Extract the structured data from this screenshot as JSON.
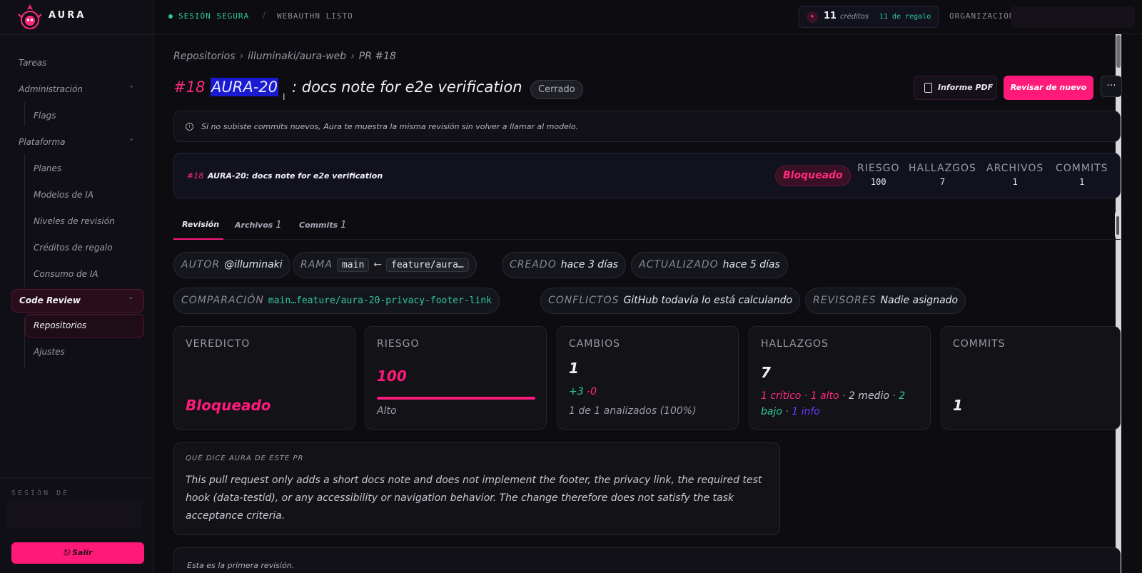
{
  "app": {
    "name": "AURA"
  },
  "topbar": {
    "secure": "SESIÓN SEGURA",
    "separator": "/",
    "webauthn": "WEBAUTHN LISTO",
    "credits_num": "11",
    "credits_label": "créditos",
    "credits_gift": "11 de regalo",
    "org_label": "ORGANIZACIÓN"
  },
  "sidebar": {
    "items": [
      {
        "label": "Tareas"
      },
      {
        "label": "Administración"
      },
      {
        "label": "Flags"
      },
      {
        "label": "Plataforma"
      },
      {
        "label": "Planes"
      },
      {
        "label": "Modelos de IA"
      },
      {
        "label": "Niveles de revisión"
      },
      {
        "label": "Créditos de regalo"
      },
      {
        "label": "Consumo de IA"
      },
      {
        "label": "Code Review"
      },
      {
        "label": "Repositorios"
      },
      {
        "label": "Ajustes"
      }
    ],
    "session_label": "SESIÓN DE",
    "logout": "Salir"
  },
  "breadcrumb": {
    "items": [
      "Repositorios",
      "illuminaki/aura-web",
      "PR #18"
    ],
    "sep": "›"
  },
  "pr": {
    "number": "#18",
    "key": "AURA-20",
    "title": ": docs note for e2e verification",
    "status": "Cerrado",
    "pdf_label": "Informe PDF",
    "review_label": "Revisar de nuevo",
    "more_label": "···"
  },
  "notice": {
    "text": "Si no subiste commits nuevos, Aura te muestra la misma revisión sin volver a llamar al modelo."
  },
  "summary": {
    "num": "#18",
    "title": "AURA-20: docs note for e2e verification",
    "badge": "Bloqueado",
    "stats": [
      {
        "key": "RIESGO",
        "value": "100"
      },
      {
        "key": "HALLAZGOS",
        "value": "7"
      },
      {
        "key": "ARCHIVOS",
        "value": "1"
      },
      {
        "key": "COMMITS",
        "value": "1"
      }
    ]
  },
  "tabs": [
    {
      "label": "Revisión",
      "count": ""
    },
    {
      "label": "Archivos",
      "count": "1"
    },
    {
      "label": "Commits",
      "count": "1"
    }
  ],
  "meta": {
    "author_k": "AUTOR",
    "author_v": "@illuminaki",
    "branch_k": "RAMA",
    "branch_base": "main",
    "branch_arrow": "←",
    "branch_head": "feature/aura…",
    "created_k": "CREADO",
    "created_v": "hace 3 días",
    "updated_k": "ACTUALIZADO",
    "updated_v": "hace 5 días",
    "compare_k": "COMPARACIÓN",
    "compare_v": "main…feature/aura-20-privacy-footer-link",
    "conflicts_k": "CONFLICTOS",
    "conflicts_v": "GitHub todavía lo está calculando",
    "reviewers_k": "REVISORES",
    "reviewers_v": "Nadie asignado"
  },
  "cards": {
    "verdict_k": "VEREDICTO",
    "verdict_v": "Bloqueado",
    "risk_k": "RIESGO",
    "risk_v": "100",
    "risk_level": "Alto",
    "risk_fraction": 1.0,
    "changes_k": "CAMBIOS",
    "changes_v": "1",
    "changes_plus": "+3",
    "changes_minus": "-0",
    "changes_analyzed": "1 de 1 analizados (100%)",
    "findings_k": "HALLAZGOS",
    "findings_v": "7",
    "findings_critical": "1 crítico",
    "findings_high": "1 alto",
    "findings_medium": "2 medio",
    "findings_low_num": "2",
    "findings_low_word": "bajo",
    "findings_info": "1 info",
    "findings_sep": " · ",
    "commits_k": "COMMITS",
    "commits_v": "1"
  },
  "aura": {
    "label": "QUÉ DICE AURA DE ESTE PR",
    "text": "This pull request only adds a short docs note and does not implement the footer, the privacy link, the required test hook (data-testid), or any accessibility or navigation behavior. The change therefore does not satisfy the task acceptance criteria."
  },
  "bottom": {
    "text": "Esta es la primera revisión."
  },
  "colors": {
    "accent": "#ff1a7a",
    "success": "#2ec99b",
    "info": "#6a3cff",
    "bg": "#0c0c11"
  }
}
